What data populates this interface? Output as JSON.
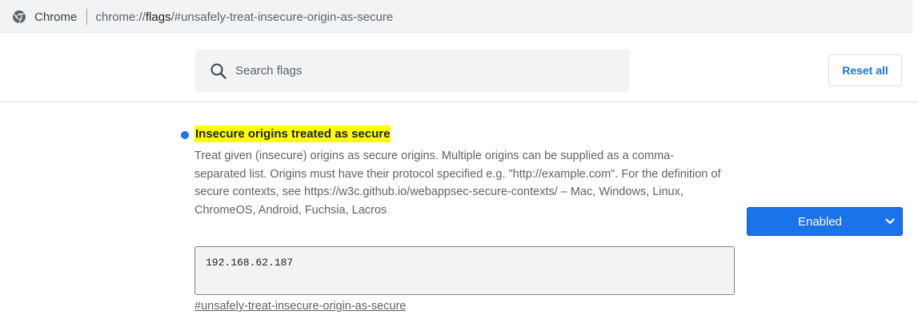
{
  "omnibox": {
    "site_label": "Chrome",
    "url_prefix": "chrome://",
    "url_host": "flags",
    "url_path": "/#unsafely-treat-insecure-origin-as-secure"
  },
  "header": {
    "search_placeholder": "Search flags",
    "reset_label": "Reset all"
  },
  "flag": {
    "title": "Insecure origins treated as secure",
    "description": "Treat given (insecure) origins as secure origins. Multiple origins can be supplied as a comma-separated list. Origins must have their protocol specified e.g. \"http://example.com\". For the definition of secure contexts, see https://w3c.github.io/webappsec-secure-contexts/ – Mac, Windows, Linux, ChromeOS, Android, Fuchsia, Lacros",
    "origins_value": "192.168.62.187",
    "permalink": "#unsafely-treat-insecure-origin-as-secure",
    "state": "Enabled"
  },
  "colors": {
    "accent": "#1a73e8",
    "highlight": "#ffff00"
  },
  "icons": {
    "site": "chrome-icon",
    "search": "search-icon",
    "dropdown": "chevron-down-icon"
  }
}
